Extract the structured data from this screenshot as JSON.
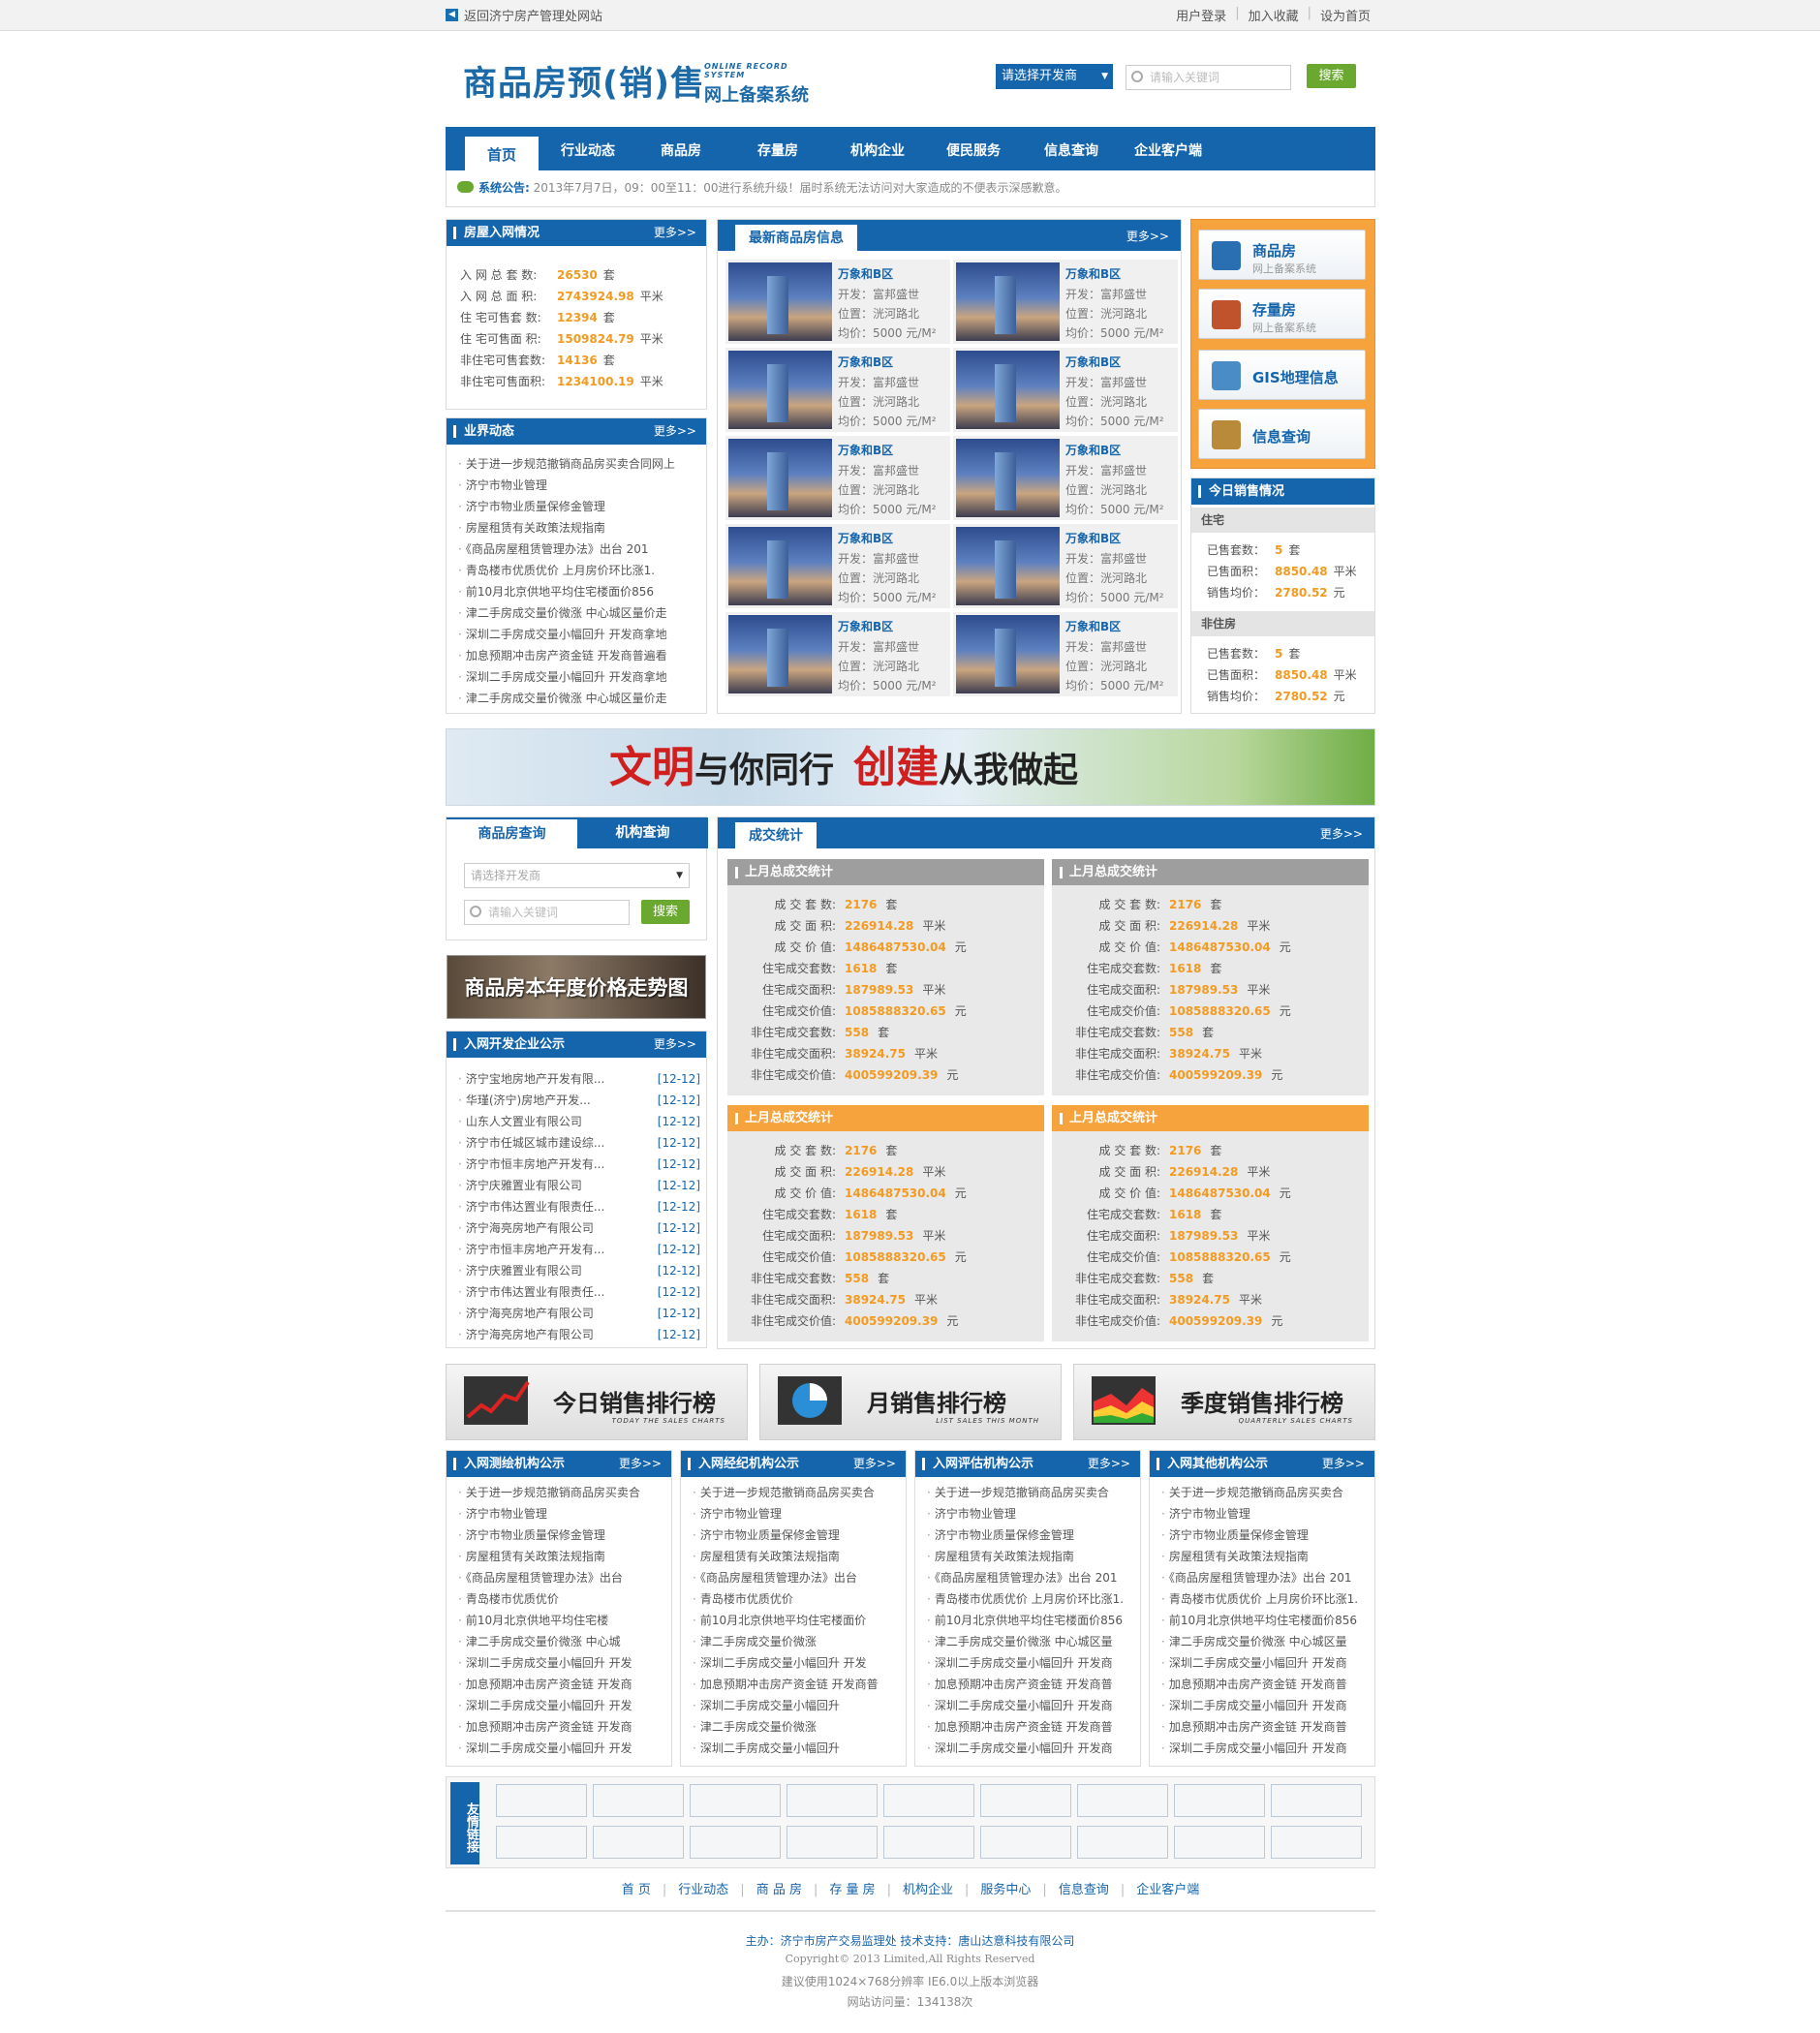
{
  "topbar": {
    "back_link": "返回济宁房产管理处网站",
    "links": [
      "用户登录",
      "加入收藏",
      "设为首页"
    ]
  },
  "header": {
    "logo": "商品房预(销)售",
    "logo_en": "ONLINE RECORD SYSTEM",
    "logo_sub": "网上备案系统",
    "developer_select": "请选择开发商",
    "search_placeholder": "请输入关键词",
    "search_button": "搜索"
  },
  "nav": [
    "首页",
    "行业动态",
    "商品房",
    "存量房",
    "机构企业",
    "便民服务",
    "信息查询",
    "企业客户端"
  ],
  "notice": {
    "label": "系统公告:",
    "text": "2013年7月7日，09：00至11：00进行系统升级！届时系统无法访问对大家造成的不便表示深感歉意。"
  },
  "housing_stats": {
    "title": "房屋入网情况",
    "more": "更多>>",
    "rows": [
      {
        "label": "入 网 总 套 数:",
        "value": "26530",
        "unit": "套"
      },
      {
        "label": "入 网 总 面 积:",
        "value": "2743924.98",
        "unit": "平米"
      },
      {
        "label": "住 宅可售套 数:",
        "value": "12394",
        "unit": "套"
      },
      {
        "label": "住 宅可售面 积:",
        "value": "1509824.79",
        "unit": "平米"
      },
      {
        "label": "非住宅可售套数:",
        "value": "14136",
        "unit": "套"
      },
      {
        "label": "非住宅可售面积:",
        "value": "1234100.19",
        "unit": "平米"
      }
    ]
  },
  "industry_news": {
    "title": "业界动态",
    "more": "更多>>",
    "items": [
      "关于进一步规范撤销商品房买卖合同网上",
      "济宁市物业管理",
      "济宁市物业质量保修金管理",
      "房屋租赁有关政策法规指南",
      "《商品房屋租赁管理办法》出台 201",
      "青岛楼市优质优价 上月房价环比涨1.",
      "前10月北京供地平均住宅楼面价856",
      "津二手房成交量价微涨 中心城区量价走",
      "深圳二手房成交量小幅回升 开发商拿地",
      "加息预期冲击房产资金链 开发商普遍看",
      "深圳二手房成交量小幅回升 开发商拿地",
      "津二手房成交量价微涨 中心城区量价走"
    ]
  },
  "latest_houses": {
    "title": "最新商品房信息",
    "more": "更多>>",
    "item": {
      "name": "万象和B区",
      "dev": "开发：富邦盛世",
      "loc": "位置：洸河路北",
      "price": "均价：5000 元/M²"
    }
  },
  "quick_links": [
    {
      "title": "商品房",
      "sub": "网上备案系统",
      "icon": "store-icon"
    },
    {
      "title": "存量房",
      "sub": "网上备案系统",
      "icon": "house-icon"
    },
    {
      "title": "GIS地理信息",
      "sub": "",
      "icon": "map-icon"
    },
    {
      "title": "信息查询",
      "sub": "",
      "icon": "magnifier-icon"
    }
  ],
  "today_sales": {
    "title": "今日销售情况",
    "residential": {
      "label": "住宅",
      "rows": [
        {
          "label": "已售套数：",
          "value": "5",
          "unit": "套"
        },
        {
          "label": "已售面积：",
          "value": "8850.48",
          "unit": "平米"
        },
        {
          "label": "销售均价：",
          "value": "2780.52",
          "unit": "元"
        }
      ]
    },
    "non_residential": {
      "label": "非住房",
      "rows": [
        {
          "label": "已售套数：",
          "value": "5",
          "unit": "套"
        },
        {
          "label": "已售面积：",
          "value": "8850.48",
          "unit": "平米"
        },
        {
          "label": "销售均价：",
          "value": "2780.52",
          "unit": "元"
        }
      ]
    }
  },
  "banner": {
    "part1": "文明",
    "part2": "与你同行",
    "part3": "创建",
    "part4": "从我做起"
  },
  "query": {
    "tabs": [
      "商品房查询",
      "机构查询"
    ],
    "select": "请选择开发商",
    "placeholder": "请输入关键词",
    "button": "搜索",
    "trend_banner": "商品房本年度价格走势图"
  },
  "dev_notice": {
    "title": "入网开发企业公示",
    "more": "更多>>",
    "items": [
      {
        "name": "济宁宝地房地产开发有限...",
        "date": "[12-12]"
      },
      {
        "name": "华瑾(济宁)房地产开发...",
        "date": "[12-12]"
      },
      {
        "name": "山东人文置业有限公司",
        "date": "[12-12]"
      },
      {
        "name": "济宁市任城区城市建设综...",
        "date": "[12-12]"
      },
      {
        "name": "济宁市恒丰房地产开发有...",
        "date": "[12-12]"
      },
      {
        "name": "济宁庆雅置业有限公司",
        "date": "[12-12]"
      },
      {
        "name": "济宁市伟达置业有限责任...",
        "date": "[12-12]"
      },
      {
        "name": "济宁海亮房地产有限公司",
        "date": "[12-12]"
      },
      {
        "name": "济宁市恒丰房地产开发有...",
        "date": "[12-12]"
      },
      {
        "name": "济宁庆雅置业有限公司",
        "date": "[12-12]"
      },
      {
        "name": "济宁市伟达置业有限责任...",
        "date": "[12-12]"
      },
      {
        "name": "济宁海亮房地产有限公司",
        "date": "[12-12]"
      },
      {
        "name": "济宁海亮房地产有限公司",
        "date": "[12-12]"
      }
    ]
  },
  "transactions": {
    "title": "成交统计",
    "more": "更多>>",
    "box_title": "上月总成交统计",
    "rows": [
      {
        "label": "成 交 套 数:",
        "value": "2176",
        "unit": "套"
      },
      {
        "label": "成 交 面 积:",
        "value": "226914.28",
        "unit": "平米"
      },
      {
        "label": "成 交 价 值:",
        "value": "1486487530.04",
        "unit": "元"
      },
      {
        "label": "住宅成交套数:",
        "value": "1618",
        "unit": "套"
      },
      {
        "label": "住宅成交面积:",
        "value": "187989.53",
        "unit": "平米"
      },
      {
        "label": "住宅成交价值:",
        "value": "1085888320.65",
        "unit": "元"
      },
      {
        "label": "非住宅成交套数:",
        "value": "558",
        "unit": "套"
      },
      {
        "label": "非住宅成交面积:",
        "value": "38924.75",
        "unit": "平米"
      },
      {
        "label": "非住宅成交价值:",
        "value": "400599209.39",
        "unit": "元"
      }
    ]
  },
  "rankings": [
    {
      "title": "今日销售排行榜",
      "en": "TODAY THE SALES CHARTS"
    },
    {
      "title": "月销售排行榜",
      "en": "LIST SALES THIS MONTH"
    },
    {
      "title": "季度销售排行榜",
      "en": "QUARTERLY SALES CHARTS"
    }
  ],
  "org_lists": [
    {
      "title": "入网测绘机构公示",
      "more": "更多>>",
      "items": [
        "关于进一步规范撤销商品房买卖合",
        "济宁市物业管理",
        "济宁市物业质量保修金管理",
        "房屋租赁有关政策法规指南",
        "《商品房屋租赁管理办法》出台",
        "青岛楼市优质优价",
        "前10月北京供地平均住宅楼",
        "津二手房成交量价微涨 中心城",
        "深圳二手房成交量小幅回升 开发",
        "加息预期冲击房产资金链 开发商",
        "深圳二手房成交量小幅回升 开发",
        "加息预期冲击房产资金链 开发商",
        "深圳二手房成交量小幅回升 开发"
      ]
    },
    {
      "title": "入网经纪机构公示",
      "more": "更多>>",
      "items": [
        "关于进一步规范撤销商品房买卖合",
        "济宁市物业管理",
        "济宁市物业质量保修金管理",
        "房屋租赁有关政策法规指南",
        "《商品房屋租赁管理办法》出台",
        "青岛楼市优质优价",
        "前10月北京供地平均住宅楼面价",
        "津二手房成交量价微涨",
        "深圳二手房成交量小幅回升 开发",
        "加息预期冲击房产资金链 开发商普",
        "深圳二手房成交量小幅回升",
        "津二手房成交量价微涨",
        "深圳二手房成交量小幅回升"
      ]
    },
    {
      "title": "入网评估机构公示",
      "more": "更多>>",
      "items": [
        "关于进一步规范撤销商品房买卖合",
        "济宁市物业管理",
        "济宁市物业质量保修金管理",
        "房屋租赁有关政策法规指南",
        "《商品房屋租赁管理办法》出台 201",
        "青岛楼市优质优价 上月房价环比涨1.",
        "前10月北京供地平均住宅楼面价856",
        "津二手房成交量价微涨 中心城区量",
        "深圳二手房成交量小幅回升 开发商",
        "加息预期冲击房产资金链 开发商普",
        "深圳二手房成交量小幅回升 开发商",
        "加息预期冲击房产资金链 开发商普",
        "深圳二手房成交量小幅回升 开发商"
      ]
    },
    {
      "title": "入网其他机构公示",
      "more": "更多>>",
      "items": [
        "关于进一步规范撤销商品房买卖合",
        "济宁市物业管理",
        "济宁市物业质量保修金管理",
        "房屋租赁有关政策法规指南",
        "《商品房屋租赁管理办法》出台 201",
        "青岛楼市优质优价 上月房价环比涨1.",
        "前10月北京供地平均住宅楼面价856",
        "津二手房成交量价微涨 中心城区量",
        "深圳二手房成交量小幅回升 开发商",
        "加息预期冲击房产资金链 开发商普",
        "深圳二手房成交量小幅回升 开发商",
        "加息预期冲击房产资金链 开发商普",
        "深圳二手房成交量小幅回升 开发商"
      ]
    }
  ],
  "friend_links": {
    "label": "友情链接"
  },
  "footer": {
    "nav": [
      "首 页",
      "行业动态",
      "商 品 房",
      "存 量 房",
      "机构企业",
      "服务中心",
      "信息查询",
      "企业客户端"
    ],
    "host": "主办：济宁市房产交易监理处  技术支持：唐山达意科技有限公司",
    "copyright": "Copyright© 2013 Limited,All Rights Reserved",
    "browser": "建议使用1024×768分辨率 IE6.0以上版本浏览器",
    "visits": "网站访问量：134138次"
  }
}
